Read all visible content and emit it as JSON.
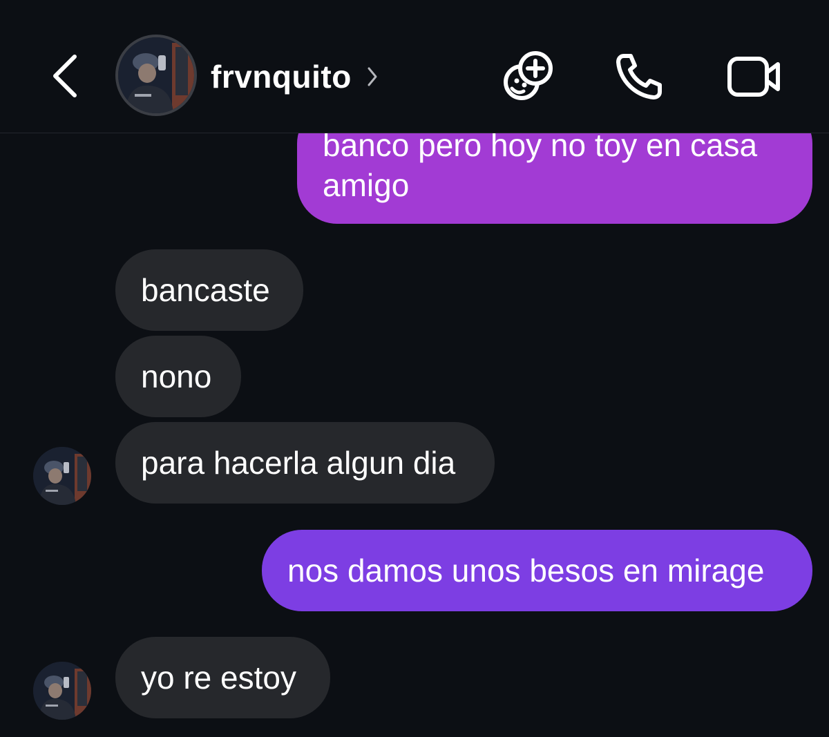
{
  "header": {
    "back_icon": "chevron-left-icon",
    "username": "frvnquito",
    "username_chevron_icon": "chevron-right-icon",
    "actions": [
      {
        "icon": "sticker-add-icon"
      },
      {
        "icon": "phone-icon"
      },
      {
        "icon": "video-camera-icon"
      }
    ]
  },
  "messages": [
    {
      "direction": "outgoing",
      "text": "banco pero hoy no toy en casa amigo"
    },
    {
      "direction": "incoming",
      "text": "bancaste"
    },
    {
      "direction": "incoming",
      "text": "nono"
    },
    {
      "direction": "incoming",
      "text": "para hacerla algun dia"
    },
    {
      "direction": "outgoing",
      "text": "nos damos unos besos en mirage"
    },
    {
      "direction": "incoming",
      "text": "yo re estoy"
    }
  ],
  "colors": {
    "background": "#0c0f14",
    "incoming_bubble": "#26282c",
    "outgoing_bubble_top": "#a23bd4",
    "outgoing_bubble_bottom": "#7d3ee3",
    "text": "#ffffff"
  }
}
